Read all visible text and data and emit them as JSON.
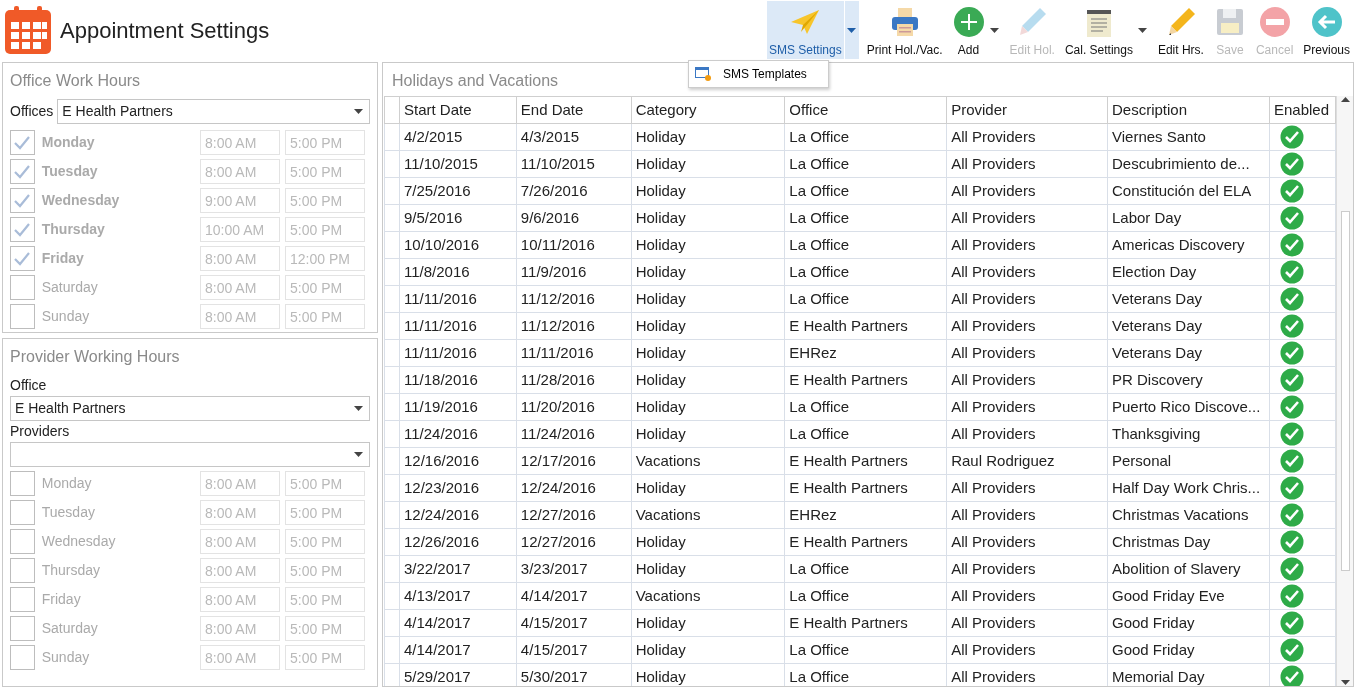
{
  "window": {
    "title": "Appointment Settings"
  },
  "toolbar": [
    {
      "kind": "plane",
      "label": "SMS Settings",
      "disabled": false,
      "selected": true,
      "dropdown": true
    },
    {
      "kind": "printer",
      "label": "Print Hol./Vac.",
      "disabled": false,
      "selected": false,
      "dropdown": false
    },
    {
      "kind": "plus",
      "label": "Add",
      "disabled": false,
      "selected": false,
      "dropdown": true
    },
    {
      "kind": "pencil-light",
      "label": "Edit Hol.",
      "disabled": true,
      "selected": false,
      "dropdown": false
    },
    {
      "kind": "notepad",
      "label": "Cal. Settings",
      "disabled": false,
      "selected": false,
      "dropdown": true
    },
    {
      "kind": "pencil",
      "label": "Edit Hrs.",
      "disabled": false,
      "selected": false,
      "dropdown": false
    },
    {
      "kind": "floppy",
      "label": "Save",
      "disabled": true,
      "selected": false,
      "dropdown": false
    },
    {
      "kind": "minus",
      "label": "Cancel",
      "disabled": true,
      "selected": false,
      "dropdown": false
    },
    {
      "kind": "back",
      "label": "Previous",
      "disabled": false,
      "selected": false,
      "dropdown": false
    }
  ],
  "dropdown_menu": {
    "items": [
      {
        "label": "SMS Templates"
      }
    ]
  },
  "office_work_hours": {
    "title": "Office Work Hours",
    "offices_label": "Offices",
    "office": "E Health Partners",
    "days": [
      {
        "day": "Monday",
        "checked": true,
        "start": "8:00 AM",
        "end": "5:00 PM"
      },
      {
        "day": "Tuesday",
        "checked": true,
        "start": "8:00 AM",
        "end": "5:00 PM"
      },
      {
        "day": "Wednesday",
        "checked": true,
        "start": "9:00 AM",
        "end": "5:00 PM"
      },
      {
        "day": "Thursday",
        "checked": true,
        "start": "10:00 AM",
        "end": "5:00 PM"
      },
      {
        "day": "Friday",
        "checked": true,
        "start": "8:00 AM",
        "end": "12:00 PM"
      },
      {
        "day": "Saturday",
        "checked": false,
        "start": "8:00 AM",
        "end": "5:00 PM"
      },
      {
        "day": "Sunday",
        "checked": false,
        "start": "8:00 AM",
        "end": "5:00 PM"
      }
    ]
  },
  "provider_working_hours": {
    "title": "Provider Working Hours",
    "office_label": "Office",
    "office": "E Health Partners",
    "providers_label": "Providers",
    "days": [
      {
        "day": "Monday",
        "checked": false,
        "start": "8:00 AM",
        "end": "5:00 PM"
      },
      {
        "day": "Tuesday",
        "checked": false,
        "start": "8:00 AM",
        "end": "5:00 PM"
      },
      {
        "day": "Wednesday",
        "checked": false,
        "start": "8:00 AM",
        "end": "5:00 PM"
      },
      {
        "day": "Thursday",
        "checked": false,
        "start": "8:00 AM",
        "end": "5:00 PM"
      },
      {
        "day": "Friday",
        "checked": false,
        "start": "8:00 AM",
        "end": "5:00 PM"
      },
      {
        "day": "Saturday",
        "checked": false,
        "start": "8:00 AM",
        "end": "5:00 PM"
      },
      {
        "day": "Sunday",
        "checked": false,
        "start": "8:00 AM",
        "end": "5:00 PM"
      }
    ]
  },
  "holidays": {
    "title": "Holidays and Vacations",
    "columns": [
      "Start Date",
      "End Date",
      "Category",
      "Office",
      "Provider",
      "Description",
      "Enabled"
    ],
    "rows": [
      {
        "start": "4/2/2015",
        "end": "4/3/2015",
        "category": "Holiday",
        "office": "La Office",
        "provider": "All Providers",
        "description": "Viernes Santo",
        "enabled": true
      },
      {
        "start": "11/10/2015",
        "end": "11/10/2015",
        "category": "Holiday",
        "office": "La Office",
        "provider": "All Providers",
        "description": "Descubrimiento de...",
        "enabled": true
      },
      {
        "start": "7/25/2016",
        "end": "7/26/2016",
        "category": "Holiday",
        "office": "La Office",
        "provider": "All Providers",
        "description": "Constitución del ELA",
        "enabled": true
      },
      {
        "start": "9/5/2016",
        "end": "9/6/2016",
        "category": "Holiday",
        "office": "La Office",
        "provider": "All Providers",
        "description": "Labor Day",
        "enabled": true
      },
      {
        "start": "10/10/2016",
        "end": "10/11/2016",
        "category": "Holiday",
        "office": "La Office",
        "provider": "All Providers",
        "description": "Americas Discovery",
        "enabled": true
      },
      {
        "start": "11/8/2016",
        "end": "11/9/2016",
        "category": "Holiday",
        "office": "La Office",
        "provider": "All Providers",
        "description": "Election Day",
        "enabled": true
      },
      {
        "start": "11/11/2016",
        "end": "11/12/2016",
        "category": "Holiday",
        "office": "La Office",
        "provider": "All Providers",
        "description": "Veterans Day",
        "enabled": true
      },
      {
        "start": "11/11/2016",
        "end": "11/12/2016",
        "category": "Holiday",
        "office": "E Health Partners",
        "provider": "All Providers",
        "description": "Veterans Day",
        "enabled": true
      },
      {
        "start": "11/11/2016",
        "end": "11/11/2016",
        "category": "Holiday",
        "office": "EHRez",
        "provider": "All Providers",
        "description": "Veterans Day",
        "enabled": true
      },
      {
        "start": "11/18/2016",
        "end": "11/28/2016",
        "category": "Holiday",
        "office": "E Health Partners",
        "provider": "All Providers",
        "description": "PR Discovery",
        "enabled": true
      },
      {
        "start": "11/19/2016",
        "end": "11/20/2016",
        "category": "Holiday",
        "office": "La Office",
        "provider": "All Providers",
        "description": "Puerto Rico Discove...",
        "enabled": true
      },
      {
        "start": "11/24/2016",
        "end": "11/24/2016",
        "category": "Holiday",
        "office": "La Office",
        "provider": "All Providers",
        "description": "Thanksgiving",
        "enabled": true
      },
      {
        "start": "12/16/2016",
        "end": "12/17/2016",
        "category": "Vacations",
        "office": "E Health Partners",
        "provider": "Raul Rodriguez",
        "description": "Personal",
        "enabled": true
      },
      {
        "start": "12/23/2016",
        "end": "12/24/2016",
        "category": "Holiday",
        "office": "E Health Partners",
        "provider": "All Providers",
        "description": "Half Day Work Chris...",
        "enabled": true
      },
      {
        "start": "12/24/2016",
        "end": "12/27/2016",
        "category": "Vacations",
        "office": "EHRez",
        "provider": "All Providers",
        "description": "Christmas Vacations",
        "enabled": true
      },
      {
        "start": "12/26/2016",
        "end": "12/27/2016",
        "category": "Holiday",
        "office": "E Health Partners",
        "provider": "All Providers",
        "description": "Christmas Day",
        "enabled": true
      },
      {
        "start": "3/22/2017",
        "end": "3/23/2017",
        "category": "Holiday",
        "office": "La Office",
        "provider": "All Providers",
        "description": "Abolition of Slavery",
        "enabled": true
      },
      {
        "start": "4/13/2017",
        "end": "4/14/2017",
        "category": "Vacations",
        "office": "La Office",
        "provider": "All Providers",
        "description": "Good Friday Eve",
        "enabled": true
      },
      {
        "start": "4/14/2017",
        "end": "4/15/2017",
        "category": "Holiday",
        "office": "E Health Partners",
        "provider": "All Providers",
        "description": "Good Friday",
        "enabled": true
      },
      {
        "start": "4/14/2017",
        "end": "4/15/2017",
        "category": "Holiday",
        "office": "La Office",
        "provider": "All Providers",
        "description": "Good Friday",
        "enabled": true
      },
      {
        "start": "5/29/2017",
        "end": "5/30/2017",
        "category": "Holiday",
        "office": "La Office",
        "provider": "All Providers",
        "description": "Memorial Day",
        "enabled": true
      }
    ]
  }
}
